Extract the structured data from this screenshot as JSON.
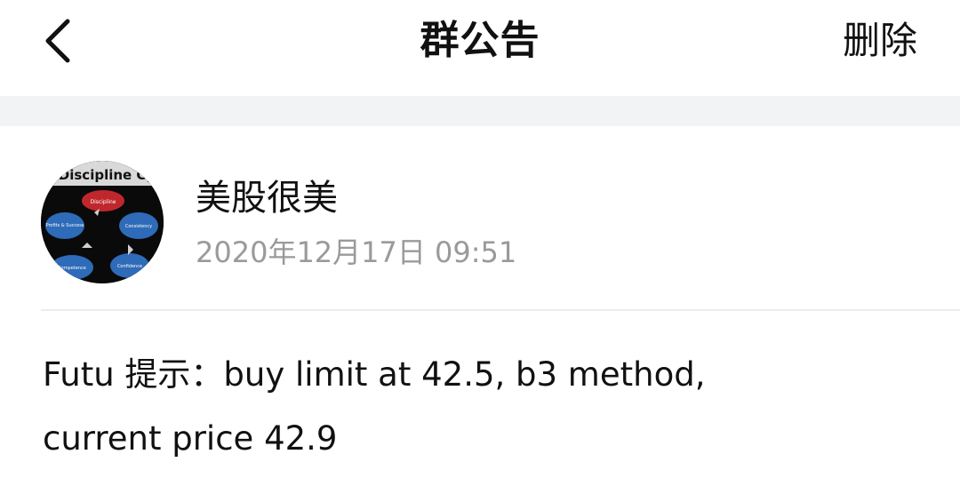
{
  "header": {
    "title": "群公告",
    "delete_label": "删除"
  },
  "icons": {
    "back": "chevron-left-icon",
    "avatar": "discipline-cycle-avatar"
  },
  "avatar": {
    "banner_text": "Discipline Cy",
    "center_label": "Discipline",
    "nodes": [
      "Profits & Success",
      "Consistency",
      "Confidence",
      "Competence"
    ]
  },
  "post": {
    "author": "美股很美",
    "date": "2020年12月17日 09:51",
    "lines": [
      "Futu 提示：buy limit at 42.5, b3 method,",
      "current price 42.9"
    ]
  },
  "colors": {
    "band": "#f2f3f5",
    "date_text": "#9a9a9a",
    "divider": "#ececec"
  }
}
